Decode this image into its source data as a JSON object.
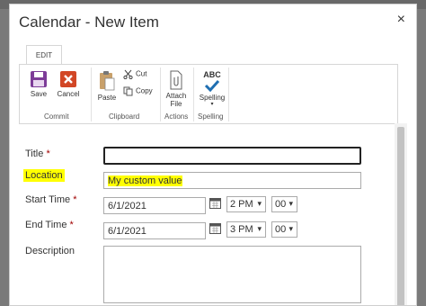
{
  "dialog": {
    "title": "Calendar - New Item",
    "close_glyph": "×"
  },
  "ribbon": {
    "tab_label": "EDIT",
    "groups": {
      "commit": "Commit",
      "clipboard": "Clipboard",
      "actions": "Actions",
      "spelling": "Spelling"
    },
    "buttons": {
      "save": "Save",
      "cancel": "Cancel",
      "paste": "Paste",
      "cut": "Cut",
      "copy": "Copy",
      "attach_line1": "Attach",
      "attach_line2": "File",
      "spelling_abc": "ABC",
      "spelling": "Spelling"
    },
    "colors": {
      "save": "#7d3c98",
      "cancel": "#d24726",
      "check": "#1f6fb2"
    }
  },
  "form": {
    "title_label": "Title",
    "required_mark": "*",
    "title_value": "",
    "location_label": "Location",
    "location_value": "My custom value",
    "start_label": "Start Time",
    "start_date": "6/1/2021",
    "start_hour": "2 PM",
    "start_minute": "00",
    "end_label": "End Time",
    "end_date": "6/1/2021",
    "end_hour": "3 PM",
    "end_minute": "00",
    "description_label": "Description",
    "highlight_color": "#ffff00"
  }
}
